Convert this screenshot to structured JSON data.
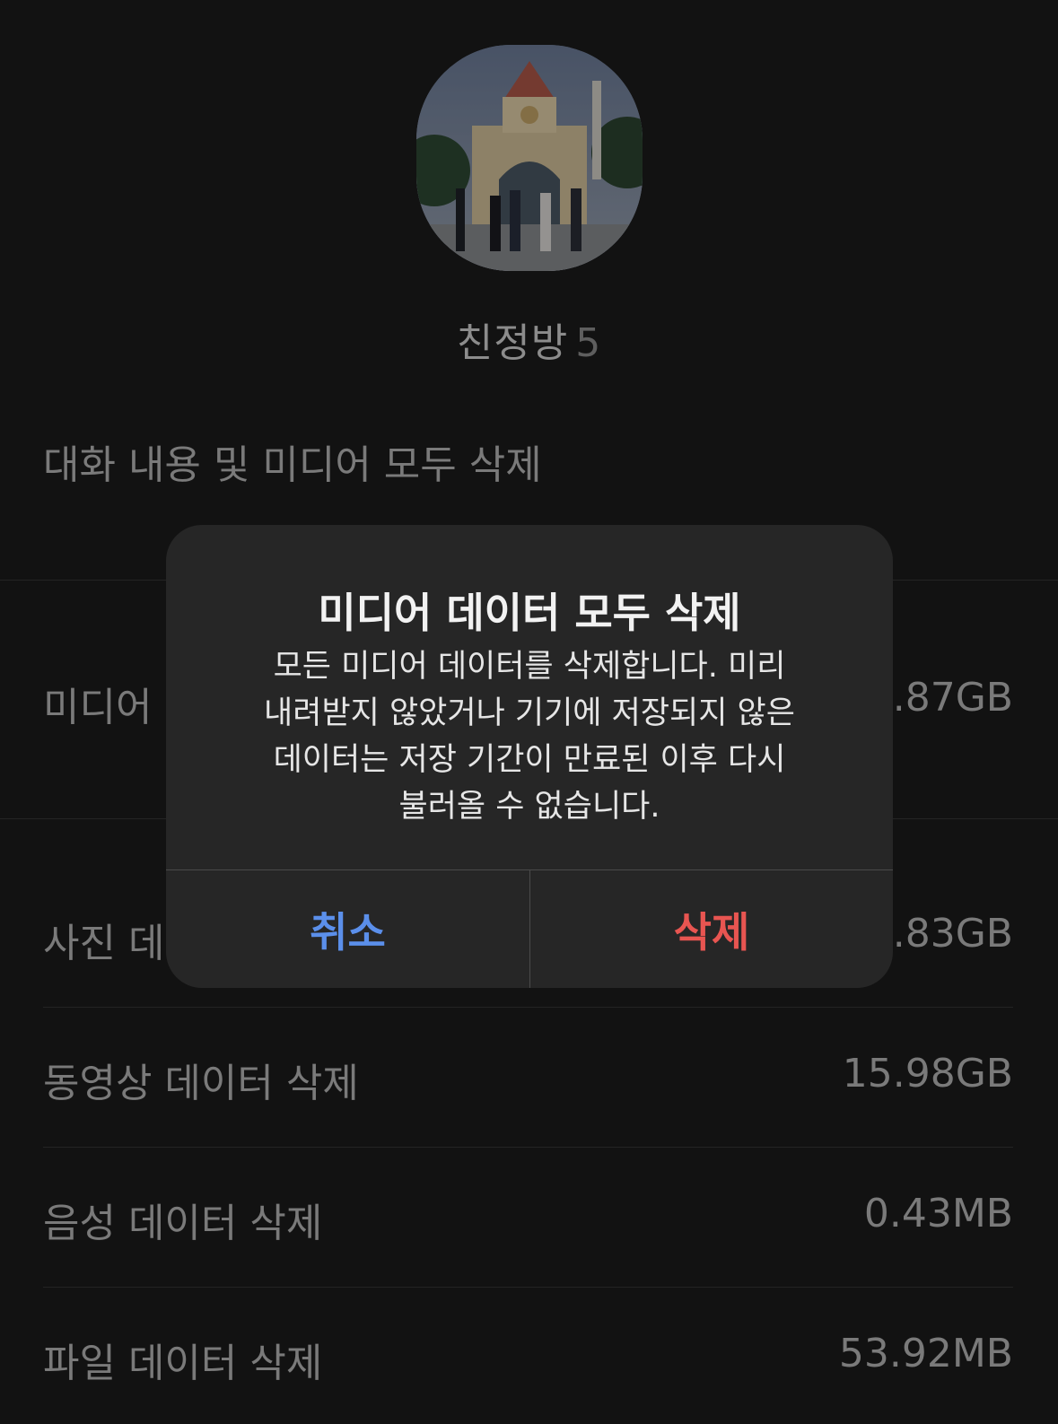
{
  "header": {
    "room_name": "친정방",
    "member_count": "5"
  },
  "delete_all_chat_label": "대화 내용 및 미디어 모두 삭제",
  "media_row": {
    "label": "미디어",
    "value": ".87GB"
  },
  "photo_row": {
    "label": "사진 데",
    "value": ".83GB"
  },
  "rows": [
    {
      "label": "동영상 데이터 삭제",
      "value": "15.98GB"
    },
    {
      "label": "음성 데이터 삭제",
      "value": "0.43MB"
    },
    {
      "label": "파일 데이터 삭제",
      "value": "53.92MB"
    }
  ],
  "alert": {
    "title": "미디어 데이터 모두 삭제",
    "message_lines": [
      "모든 미디어 데이터를 삭제합니다. 미리",
      "내려받지 않았거나 기기에 저장되지 않은",
      "데이터는 저장 기간이 만료된 이후 다시",
      "불러올 수 없습니다."
    ],
    "cancel_label": "취소",
    "delete_label": "삭제"
  },
  "colors": {
    "background": "#121212",
    "alert_background": "#262626",
    "cancel": "#5b8fea",
    "delete": "#e85551"
  }
}
